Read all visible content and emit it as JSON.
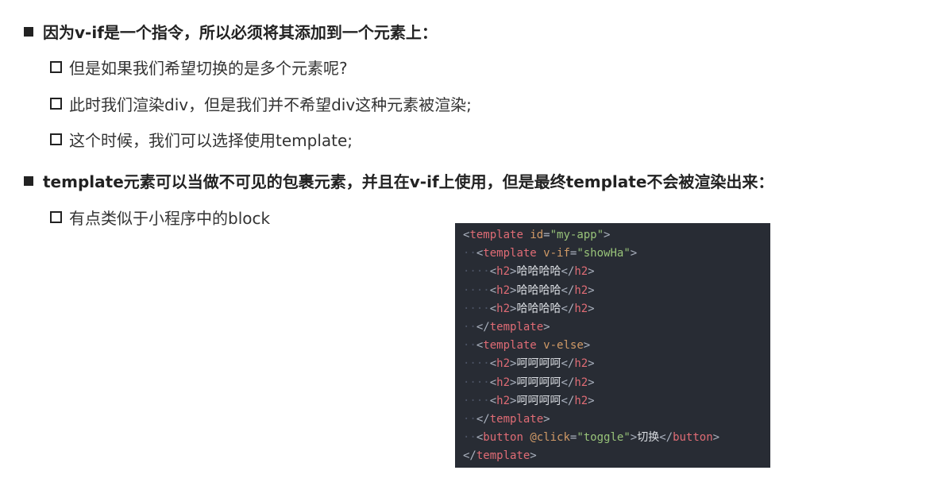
{
  "bullets": [
    {
      "text": "因为v-if是一个指令，所以必须将其添加到一个元素上：",
      "children": [
        "但是如果我们希望切换的是多个元素呢?",
        "此时我们渲染div，但是我们并不希望div这种元素被渲染;",
        "这个时候，我们可以选择使用template;"
      ]
    },
    {
      "text": "template元素可以当做不可见的包裹元素，并且在v-if上使用，但是最终template不会被渲染出来：",
      "children": [
        "有点类似于小程序中的block"
      ]
    }
  ],
  "code_lines": [
    {
      "indent": 0,
      "tokens": [
        [
          "p",
          "<"
        ],
        [
          "t",
          "template"
        ],
        [
          "p",
          " "
        ],
        [
          "a",
          "id"
        ],
        [
          "p",
          "="
        ],
        [
          "s",
          "\"my-app\""
        ],
        [
          "p",
          ">"
        ]
      ]
    },
    {
      "indent": 1,
      "tokens": [
        [
          "p",
          "<"
        ],
        [
          "t",
          "template"
        ],
        [
          "p",
          " "
        ],
        [
          "a",
          "v-if"
        ],
        [
          "p",
          "="
        ],
        [
          "s",
          "\"showHa\""
        ],
        [
          "p",
          ">"
        ]
      ]
    },
    {
      "indent": 2,
      "tokens": [
        [
          "p",
          "<"
        ],
        [
          "t",
          "h2"
        ],
        [
          "p",
          ">"
        ],
        [
          "x",
          "哈哈哈哈"
        ],
        [
          "p",
          "</"
        ],
        [
          "t",
          "h2"
        ],
        [
          "p",
          ">"
        ]
      ]
    },
    {
      "indent": 2,
      "tokens": [
        [
          "p",
          "<"
        ],
        [
          "t",
          "h2"
        ],
        [
          "p",
          ">"
        ],
        [
          "x",
          "哈哈哈哈"
        ],
        [
          "p",
          "</"
        ],
        [
          "t",
          "h2"
        ],
        [
          "p",
          ">"
        ]
      ]
    },
    {
      "indent": 2,
      "tokens": [
        [
          "p",
          "<"
        ],
        [
          "t",
          "h2"
        ],
        [
          "p",
          ">"
        ],
        [
          "x",
          "哈哈哈哈"
        ],
        [
          "p",
          "</"
        ],
        [
          "t",
          "h2"
        ],
        [
          "p",
          ">"
        ]
      ]
    },
    {
      "indent": 1,
      "tokens": [
        [
          "p",
          "</"
        ],
        [
          "t",
          "template"
        ],
        [
          "p",
          ">"
        ]
      ]
    },
    {
      "indent": 1,
      "tokens": [
        [
          "p",
          "<"
        ],
        [
          "t",
          "template"
        ],
        [
          "p",
          " "
        ],
        [
          "a",
          "v-else"
        ],
        [
          "p",
          ">"
        ]
      ]
    },
    {
      "indent": 2,
      "tokens": [
        [
          "p",
          "<"
        ],
        [
          "t",
          "h2"
        ],
        [
          "p",
          ">"
        ],
        [
          "x",
          "呵呵呵呵"
        ],
        [
          "p",
          "</"
        ],
        [
          "t",
          "h2"
        ],
        [
          "p",
          ">"
        ]
      ]
    },
    {
      "indent": 2,
      "tokens": [
        [
          "p",
          "<"
        ],
        [
          "t",
          "h2"
        ],
        [
          "p",
          ">"
        ],
        [
          "x",
          "呵呵呵呵"
        ],
        [
          "p",
          "</"
        ],
        [
          "t",
          "h2"
        ],
        [
          "p",
          ">"
        ]
      ]
    },
    {
      "indent": 2,
      "tokens": [
        [
          "p",
          "<"
        ],
        [
          "t",
          "h2"
        ],
        [
          "p",
          ">"
        ],
        [
          "x",
          "呵呵呵呵"
        ],
        [
          "p",
          "</"
        ],
        [
          "t",
          "h2"
        ],
        [
          "p",
          ">"
        ]
      ]
    },
    {
      "indent": 1,
      "tokens": [
        [
          "p",
          "</"
        ],
        [
          "t",
          "template"
        ],
        [
          "p",
          ">"
        ]
      ]
    },
    {
      "indent": 1,
      "tokens": [
        [
          "p",
          "<"
        ],
        [
          "t",
          "button"
        ],
        [
          "p",
          " "
        ],
        [
          "a",
          "@click"
        ],
        [
          "p",
          "="
        ],
        [
          "s",
          "\"toggle\""
        ],
        [
          "p",
          ">"
        ],
        [
          "x",
          "切换"
        ],
        [
          "p",
          "</"
        ],
        [
          "t",
          "button"
        ],
        [
          "p",
          ">"
        ]
      ]
    },
    {
      "indent": 0,
      "tokens": [
        [
          "p",
          "</"
        ],
        [
          "t",
          "template"
        ],
        [
          "p",
          ">"
        ]
      ]
    }
  ]
}
